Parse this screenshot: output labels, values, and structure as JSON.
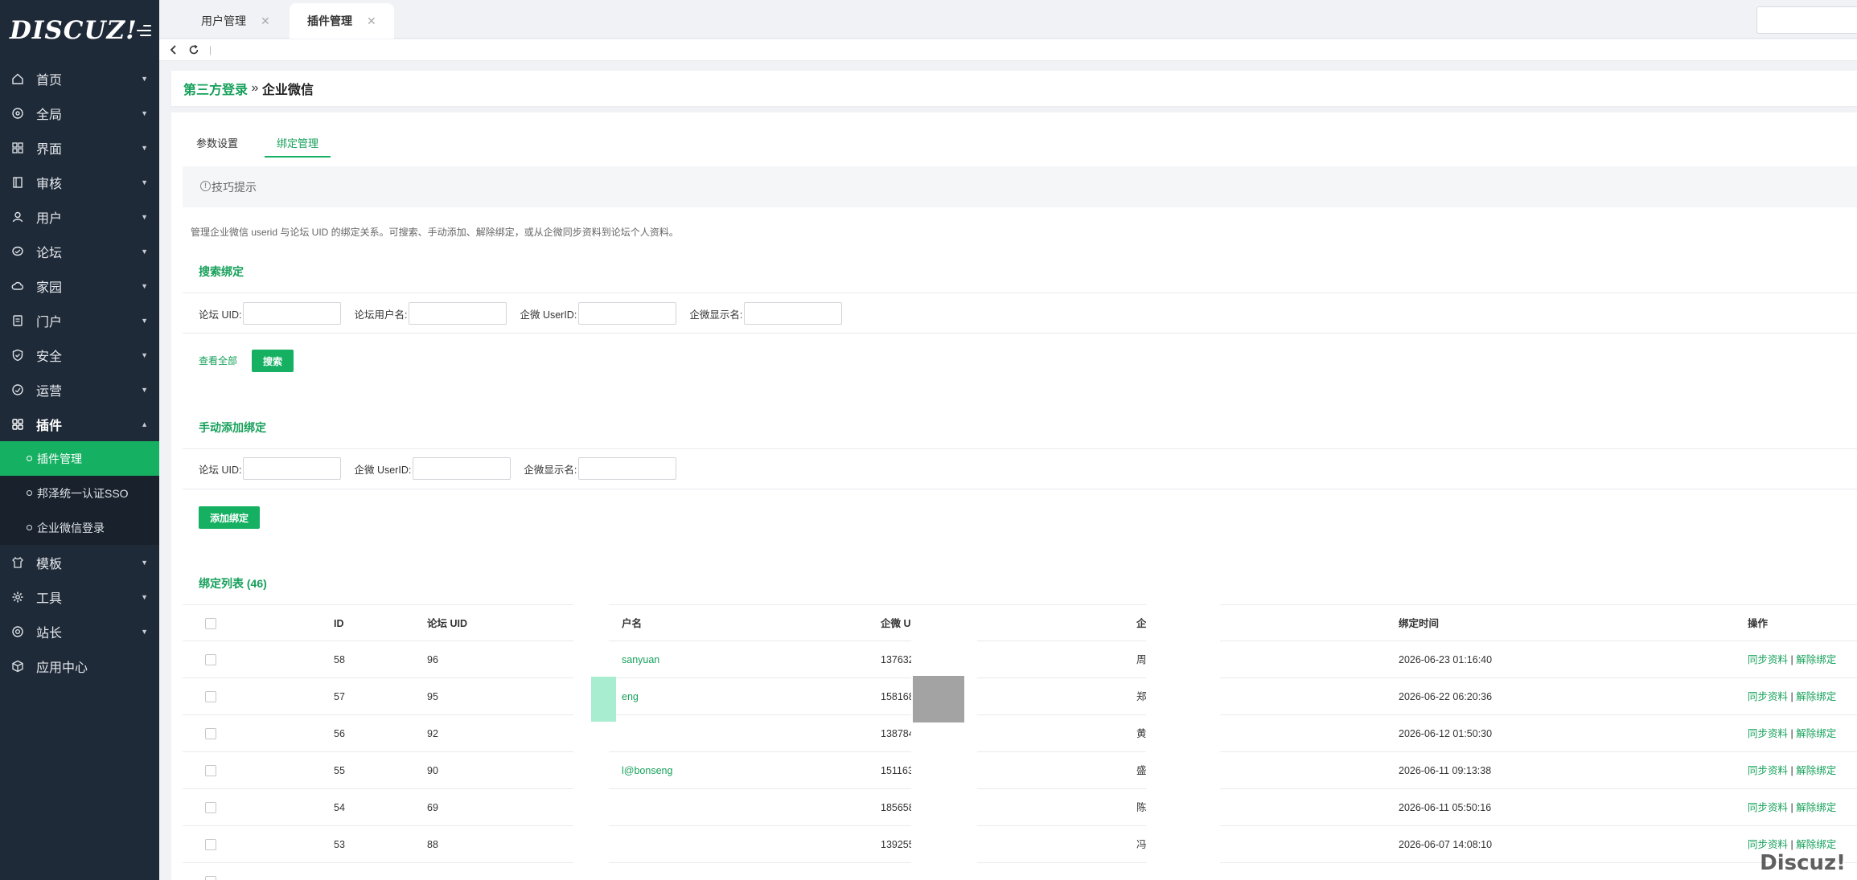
{
  "sidebar": {
    "logo": "DISCUZ!",
    "items": [
      {
        "label": "首页",
        "icon": "home-icon"
      },
      {
        "label": "全局",
        "icon": "globe-icon"
      },
      {
        "label": "界面",
        "icon": "grid-icon"
      },
      {
        "label": "审核",
        "icon": "book-icon"
      },
      {
        "label": "用户",
        "icon": "user-icon"
      },
      {
        "label": "论坛",
        "icon": "chat-icon"
      },
      {
        "label": "家园",
        "icon": "cloud-icon"
      },
      {
        "label": "门户",
        "icon": "document-icon"
      },
      {
        "label": "安全",
        "icon": "shield-icon"
      },
      {
        "label": "运营",
        "icon": "gauge-icon"
      },
      {
        "label": "插件",
        "icon": "apps-icon"
      }
    ],
    "plugin_sub": [
      "插件管理",
      "邦泽统一认证SSO",
      "企业微信登录"
    ],
    "items_after": [
      {
        "label": "模板",
        "icon": "shirt-icon"
      },
      {
        "label": "工具",
        "icon": "gear-icon"
      },
      {
        "label": "站长",
        "icon": "star-icon"
      },
      {
        "label": "应用中心",
        "icon": "cube-icon"
      }
    ]
  },
  "topbar": {
    "tabs": [
      "用户管理",
      "插件管理"
    ],
    "close_glyph": "✕"
  },
  "breadcrumb": {
    "parent": "第三方登录",
    "separator": " » ",
    "current": "企业微信"
  },
  "panel_tabs": [
    "参数设置",
    "绑定管理"
  ],
  "tip": {
    "label": "技巧提示"
  },
  "description": "管理企业微信 userid 与论坛 UID 的绑定关系。可搜索、手动添加、解除绑定，或从企微同步资料到论坛个人资料。",
  "search": {
    "title": "搜索绑定",
    "labels": [
      "论坛 UID:",
      "论坛用户名:",
      "企微 UserID:",
      "企微显示名:"
    ],
    "view_all": "查看全部",
    "search_button": "搜索"
  },
  "manual": {
    "title": "手动添加绑定",
    "labels": [
      "论坛 UID:",
      "企微 UserID:",
      "企微显示名:"
    ],
    "add_button": "添加绑定"
  },
  "list": {
    "title": "绑定列表 (46)",
    "headers": [
      "ID",
      "论坛 UID",
      "户名",
      "企微 Us",
      "企",
      "绑定时间",
      "操作"
    ],
    "rows": [
      {
        "id": "58",
        "uid": "96",
        "name": "sanyuan",
        "userid": "137632",
        "display": "周",
        "time": "2026-06-23 01:16:40"
      },
      {
        "id": "57",
        "uid": "95",
        "name": "eng",
        "userid": "158168",
        "display": "郑",
        "time": "2026-06-22 06:20:36"
      },
      {
        "id": "56",
        "uid": "92",
        "name": "",
        "userid": "138784",
        "display": "黄",
        "time": "2026-06-12 01:50:30"
      },
      {
        "id": "55",
        "uid": "90",
        "name": "l@bonseng",
        "userid": "151163",
        "display": "盛",
        "time": "2026-06-11 09:13:38"
      },
      {
        "id": "54",
        "uid": "69",
        "name": "",
        "userid": "185658",
        "display": "陈",
        "time": "2026-06-11 05:50:16"
      },
      {
        "id": "53",
        "uid": "88",
        "name": "",
        "userid": "139255",
        "display": "冯",
        "time": "2026-06-07 14:08:10"
      }
    ],
    "op_sync": "同步资料",
    "op_sep": "|",
    "op_unbind": "解除绑定"
  },
  "watermark": "Discuz!"
}
